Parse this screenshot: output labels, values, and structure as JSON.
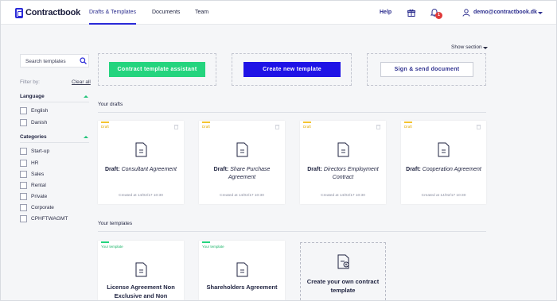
{
  "app": {
    "logo_text": "Contractbook"
  },
  "nav": {
    "items": [
      {
        "label": "Drafts & Templates",
        "active": true
      },
      {
        "label": "Documents",
        "active": false
      },
      {
        "label": "Team",
        "active": false
      }
    ],
    "help_label": "Help",
    "notification_count": "1",
    "user_email": "demo@contractbook.dk"
  },
  "sidebar": {
    "search_placeholder": "Search templates",
    "filter_by_label": "Filter by:",
    "clear_all_label": "Clear all",
    "language_heading": "Language",
    "languages": [
      "English",
      "Danish"
    ],
    "categories_heading": "Categories",
    "categories": [
      "Start-up",
      "HR",
      "Sales",
      "Rental",
      "Private",
      "Corporate",
      "CPHFTWAGMT"
    ]
  },
  "main": {
    "show_section_label": "Show section",
    "actions": {
      "assistant_label": "Contract template assistant",
      "create_label": "Create new template",
      "sign_label": "Sign & send document"
    },
    "drafts_heading": "Your drafts",
    "drafts": [
      {
        "tag": "Draft",
        "prefix": "Draft:",
        "name": "Consultant Agreement",
        "created": "Created at 14/02/17 10:30"
      },
      {
        "tag": "Draft",
        "prefix": "Draft:",
        "name": "Share Purchase Agreement",
        "created": "Created at 14/02/17 10:30"
      },
      {
        "tag": "Draft",
        "prefix": "Draft:",
        "name": "Directors Employment Contract",
        "created": "Created at 14/02/17 10:30"
      },
      {
        "tag": "Draft",
        "prefix": "Draft:",
        "name": "Cooperation Agreement",
        "created": "Created at 14/02/17 10:30"
      }
    ],
    "templates_heading": "Your templates",
    "templates": [
      {
        "tag": "Your template",
        "name": "License Agreement Non Exclusive and Non Transferable Royalties"
      },
      {
        "tag": "Your template",
        "name": "Shareholders Agreement"
      }
    ],
    "create_own_label": "Create your own contract template"
  },
  "colors": {
    "accent_blue": "#1f13e6",
    "accent_green": "#24d47e",
    "draft_yellow": "#f4c430",
    "badge_red": "#e03b3b"
  },
  "icons": [
    "logo-icon",
    "gift-icon",
    "bell-icon",
    "user-icon",
    "search-icon",
    "document-icon",
    "trash-icon",
    "add-document-icon"
  ]
}
